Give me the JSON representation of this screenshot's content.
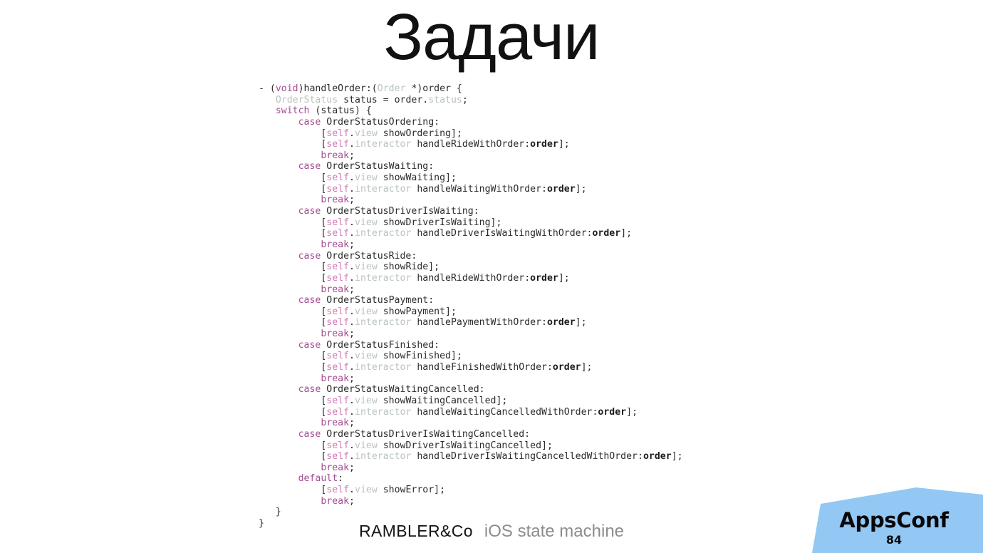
{
  "slide": {
    "title": "Задачи",
    "number": "84",
    "background_color": "#ffffff"
  },
  "code": {
    "language": "Objective-C",
    "colors": {
      "keyword": "#a34d90",
      "self": "#d07ab5",
      "type": "#b9c4bd",
      "plain": "#2b2b2b",
      "argument": "#1b1b1b"
    },
    "lines": [
      [
        {
          "t": "- (",
          "c": "pln"
        },
        {
          "t": "void",
          "c": "kw"
        },
        {
          "t": ")handleOrder:(",
          "c": "pln"
        },
        {
          "t": "Order",
          "c": "typ"
        },
        {
          "t": " *)order {",
          "c": "pln"
        }
      ],
      [
        {
          "t": "   ",
          "c": "pln"
        },
        {
          "t": "OrderStatus",
          "c": "typ"
        },
        {
          "t": " status = order.",
          "c": "pln"
        },
        {
          "t": "status",
          "c": "typ"
        },
        {
          "t": ";",
          "c": "pln"
        }
      ],
      [
        {
          "t": "   ",
          "c": "pln"
        },
        {
          "t": "switch",
          "c": "kw"
        },
        {
          "t": " (status) {",
          "c": "pln"
        }
      ],
      [
        {
          "t": "       ",
          "c": "pln"
        },
        {
          "t": "case",
          "c": "kw"
        },
        {
          "t": " OrderStatusOrdering:",
          "c": "pln"
        }
      ],
      [
        {
          "t": "           [",
          "c": "pln"
        },
        {
          "t": "self",
          "c": "slf"
        },
        {
          "t": ".",
          "c": "pln"
        },
        {
          "t": "view",
          "c": "typ"
        },
        {
          "t": " showOrdering];",
          "c": "pln"
        }
      ],
      [
        {
          "t": "           [",
          "c": "pln"
        },
        {
          "t": "self",
          "c": "slf"
        },
        {
          "t": ".",
          "c": "pln"
        },
        {
          "t": "interactor",
          "c": "typ"
        },
        {
          "t": " handleRideWithOrder:",
          "c": "pln"
        },
        {
          "t": "order",
          "c": "arg"
        },
        {
          "t": "];",
          "c": "pln"
        }
      ],
      [
        {
          "t": "           ",
          "c": "pln"
        },
        {
          "t": "break",
          "c": "kw"
        },
        {
          "t": ";",
          "c": "pln"
        }
      ],
      [
        {
          "t": "       ",
          "c": "pln"
        },
        {
          "t": "case",
          "c": "kw"
        },
        {
          "t": " OrderStatusWaiting:",
          "c": "pln"
        }
      ],
      [
        {
          "t": "           [",
          "c": "pln"
        },
        {
          "t": "self",
          "c": "slf"
        },
        {
          "t": ".",
          "c": "pln"
        },
        {
          "t": "view",
          "c": "typ"
        },
        {
          "t": " showWaiting];",
          "c": "pln"
        }
      ],
      [
        {
          "t": "           [",
          "c": "pln"
        },
        {
          "t": "self",
          "c": "slf"
        },
        {
          "t": ".",
          "c": "pln"
        },
        {
          "t": "interactor",
          "c": "typ"
        },
        {
          "t": " handleWaitingWithOrder:",
          "c": "pln"
        },
        {
          "t": "order",
          "c": "arg"
        },
        {
          "t": "];",
          "c": "pln"
        }
      ],
      [
        {
          "t": "           ",
          "c": "pln"
        },
        {
          "t": "break",
          "c": "kw"
        },
        {
          "t": ";",
          "c": "pln"
        }
      ],
      [
        {
          "t": "       ",
          "c": "pln"
        },
        {
          "t": "case",
          "c": "kw"
        },
        {
          "t": " OrderStatusDriverIsWaiting:",
          "c": "pln"
        }
      ],
      [
        {
          "t": "           [",
          "c": "pln"
        },
        {
          "t": "self",
          "c": "slf"
        },
        {
          "t": ".",
          "c": "pln"
        },
        {
          "t": "view",
          "c": "typ"
        },
        {
          "t": " showDriverIsWaiting];",
          "c": "pln"
        }
      ],
      [
        {
          "t": "           [",
          "c": "pln"
        },
        {
          "t": "self",
          "c": "slf"
        },
        {
          "t": ".",
          "c": "pln"
        },
        {
          "t": "interactor",
          "c": "typ"
        },
        {
          "t": " handleDriverIsWaitingWithOrder:",
          "c": "pln"
        },
        {
          "t": "order",
          "c": "arg"
        },
        {
          "t": "];",
          "c": "pln"
        }
      ],
      [
        {
          "t": "           ",
          "c": "pln"
        },
        {
          "t": "break",
          "c": "kw"
        },
        {
          "t": ";",
          "c": "pln"
        }
      ],
      [
        {
          "t": "       ",
          "c": "pln"
        },
        {
          "t": "case",
          "c": "kw"
        },
        {
          "t": " OrderStatusRide:",
          "c": "pln"
        }
      ],
      [
        {
          "t": "           [",
          "c": "pln"
        },
        {
          "t": "self",
          "c": "slf"
        },
        {
          "t": ".",
          "c": "pln"
        },
        {
          "t": "view",
          "c": "typ"
        },
        {
          "t": " showRide];",
          "c": "pln"
        }
      ],
      [
        {
          "t": "           [",
          "c": "pln"
        },
        {
          "t": "self",
          "c": "slf"
        },
        {
          "t": ".",
          "c": "pln"
        },
        {
          "t": "interactor",
          "c": "typ"
        },
        {
          "t": " handleRideWithOrder:",
          "c": "pln"
        },
        {
          "t": "order",
          "c": "arg"
        },
        {
          "t": "];",
          "c": "pln"
        }
      ],
      [
        {
          "t": "           ",
          "c": "pln"
        },
        {
          "t": "break",
          "c": "kw"
        },
        {
          "t": ";",
          "c": "pln"
        }
      ],
      [
        {
          "t": "       ",
          "c": "pln"
        },
        {
          "t": "case",
          "c": "kw"
        },
        {
          "t": " OrderStatusPayment:",
          "c": "pln"
        }
      ],
      [
        {
          "t": "           [",
          "c": "pln"
        },
        {
          "t": "self",
          "c": "slf"
        },
        {
          "t": ".",
          "c": "pln"
        },
        {
          "t": "view",
          "c": "typ"
        },
        {
          "t": " showPayment];",
          "c": "pln"
        }
      ],
      [
        {
          "t": "           [",
          "c": "pln"
        },
        {
          "t": "self",
          "c": "slf"
        },
        {
          "t": ".",
          "c": "pln"
        },
        {
          "t": "interactor",
          "c": "typ"
        },
        {
          "t": " handlePaymentWithOrder:",
          "c": "pln"
        },
        {
          "t": "order",
          "c": "arg"
        },
        {
          "t": "];",
          "c": "pln"
        }
      ],
      [
        {
          "t": "           ",
          "c": "pln"
        },
        {
          "t": "break",
          "c": "kw"
        },
        {
          "t": ";",
          "c": "pln"
        }
      ],
      [
        {
          "t": "       ",
          "c": "pln"
        },
        {
          "t": "case",
          "c": "kw"
        },
        {
          "t": " OrderStatusFinished:",
          "c": "pln"
        }
      ],
      [
        {
          "t": "           [",
          "c": "pln"
        },
        {
          "t": "self",
          "c": "slf"
        },
        {
          "t": ".",
          "c": "pln"
        },
        {
          "t": "view",
          "c": "typ"
        },
        {
          "t": " showFinished];",
          "c": "pln"
        }
      ],
      [
        {
          "t": "           [",
          "c": "pln"
        },
        {
          "t": "self",
          "c": "slf"
        },
        {
          "t": ".",
          "c": "pln"
        },
        {
          "t": "interactor",
          "c": "typ"
        },
        {
          "t": " handleFinishedWithOrder:",
          "c": "pln"
        },
        {
          "t": "order",
          "c": "arg"
        },
        {
          "t": "];",
          "c": "pln"
        }
      ],
      [
        {
          "t": "           ",
          "c": "pln"
        },
        {
          "t": "break",
          "c": "kw"
        },
        {
          "t": ";",
          "c": "pln"
        }
      ],
      [
        {
          "t": "       ",
          "c": "pln"
        },
        {
          "t": "case",
          "c": "kw"
        },
        {
          "t": " OrderStatusWaitingCancelled:",
          "c": "pln"
        }
      ],
      [
        {
          "t": "           [",
          "c": "pln"
        },
        {
          "t": "self",
          "c": "slf"
        },
        {
          "t": ".",
          "c": "pln"
        },
        {
          "t": "view",
          "c": "typ"
        },
        {
          "t": " showWaitingCancelled];",
          "c": "pln"
        }
      ],
      [
        {
          "t": "           [",
          "c": "pln"
        },
        {
          "t": "self",
          "c": "slf"
        },
        {
          "t": ".",
          "c": "pln"
        },
        {
          "t": "interactor",
          "c": "typ"
        },
        {
          "t": " handleWaitingCancelledWithOrder:",
          "c": "pln"
        },
        {
          "t": "order",
          "c": "arg"
        },
        {
          "t": "];",
          "c": "pln"
        }
      ],
      [
        {
          "t": "           ",
          "c": "pln"
        },
        {
          "t": "break",
          "c": "kw"
        },
        {
          "t": ";",
          "c": "pln"
        }
      ],
      [
        {
          "t": "       ",
          "c": "pln"
        },
        {
          "t": "case",
          "c": "kw"
        },
        {
          "t": " OrderStatusDriverIsWaitingCancelled:",
          "c": "pln"
        }
      ],
      [
        {
          "t": "           [",
          "c": "pln"
        },
        {
          "t": "self",
          "c": "slf"
        },
        {
          "t": ".",
          "c": "pln"
        },
        {
          "t": "view",
          "c": "typ"
        },
        {
          "t": " showDriverIsWaitingCancelled];",
          "c": "pln"
        }
      ],
      [
        {
          "t": "           [",
          "c": "pln"
        },
        {
          "t": "self",
          "c": "slf"
        },
        {
          "t": ".",
          "c": "pln"
        },
        {
          "t": "interactor",
          "c": "typ"
        },
        {
          "t": " handleDriverIsWaitingCancelledWithOrder:",
          "c": "pln"
        },
        {
          "t": "order",
          "c": "arg"
        },
        {
          "t": "];",
          "c": "pln"
        }
      ],
      [
        {
          "t": "           ",
          "c": "pln"
        },
        {
          "t": "break",
          "c": "kw"
        },
        {
          "t": ";",
          "c": "pln"
        }
      ],
      [
        {
          "t": "       ",
          "c": "pln"
        },
        {
          "t": "default",
          "c": "kw"
        },
        {
          "t": ":",
          "c": "pln"
        }
      ],
      [
        {
          "t": "           [",
          "c": "pln"
        },
        {
          "t": "self",
          "c": "slf"
        },
        {
          "t": ".",
          "c": "pln"
        },
        {
          "t": "view",
          "c": "typ"
        },
        {
          "t": " showError];",
          "c": "pln"
        }
      ],
      [
        {
          "t": "           ",
          "c": "pln"
        },
        {
          "t": "break",
          "c": "kw"
        },
        {
          "t": ";",
          "c": "pln"
        }
      ],
      [
        {
          "t": "   }",
          "c": "pln"
        }
      ],
      [
        {
          "t": "}",
          "c": "pln"
        }
      ]
    ]
  },
  "footer": {
    "logo_text": "RAMBLER&Co",
    "subtitle": "iOS state machine"
  },
  "badge": {
    "title": "AppsConf",
    "number": "84",
    "color": "#93c8f5"
  }
}
